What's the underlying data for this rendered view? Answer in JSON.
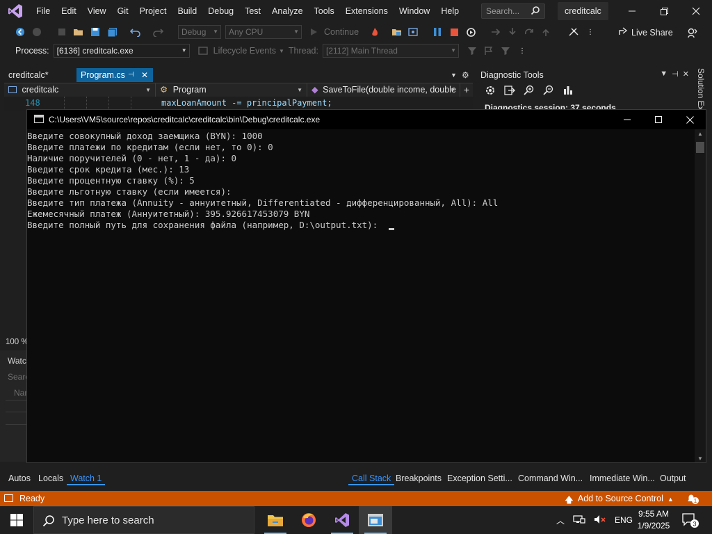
{
  "menu": {
    "items": [
      "File",
      "Edit",
      "View",
      "Git",
      "Project",
      "Build",
      "Debug",
      "Test",
      "Analyze",
      "Tools",
      "Extensions",
      "Window",
      "Help"
    ],
    "search_placeholder": "Search...",
    "solution_name": "creditcalc"
  },
  "toolbar": {
    "config": "Debug",
    "platform": "Any CPU",
    "continue_label": "Continue",
    "live_share": "Live Share"
  },
  "debug_location": {
    "process_label": "Process:",
    "process_value": "[6136] creditcalc.exe",
    "lifecycle_label": "Lifecycle Events",
    "thread_label": "Thread:",
    "thread_value": "[2112] Main Thread"
  },
  "editor": {
    "tabs": [
      {
        "label": "creditcalc*",
        "active": false
      },
      {
        "label": "Program.cs",
        "active": true
      }
    ],
    "nav": {
      "project": "creditcalc",
      "class": "Program",
      "member": "SaveToFile(double income, double"
    },
    "line_number": "148",
    "code_line": "maxLoanAmount -= principalPayment;"
  },
  "diagnostic": {
    "title": "Diagnostic Tools",
    "session": "Diagnostics session: 37 seconds"
  },
  "solution_explorer_label": "Solution Ex",
  "left_stubs": {
    "zoom": "100 %",
    "watch_title": "Watc",
    "search": "Searc",
    "name": "Nar"
  },
  "console": {
    "title": "C:\\Users\\VM5\\source\\repos\\creditcalc\\creditcalc\\bin\\Debug\\creditcalc.exe",
    "lines": [
      "Введите совокупный доход заемщика (BYN): 1000",
      "Введите платежи по кредитам (если нет, то 0): 0",
      "Наличие поручителей (0 - нет, 1 - да): 0",
      "Введите срок кредита (мес.): 13",
      "Введите процентную ставку (%): 5",
      "Введите льготную ставку (если имеется):",
      "Введите тип платежа (Annuity - аннуитетный, Differentiated - дифференцированный, All): All",
      "Ежемесячный платеж (Аннуитетный): 395.926617453079 BYN",
      "Введите полный путь для сохранения файла (например, D:\\output.txt): "
    ]
  },
  "bottom_tabs": {
    "left": [
      "Autos",
      "Locals",
      "Watch 1"
    ],
    "right": [
      "Call Stack",
      "Breakpoints",
      "Exception Setti...",
      "Command Win...",
      "Immediate Win...",
      "Output"
    ]
  },
  "status": {
    "ready": "Ready",
    "add_source": "Add to Source Control",
    "notifications": "1"
  },
  "taskbar": {
    "search_placeholder": "Type here to search",
    "lang": "ENG",
    "time": "9:55 AM",
    "date": "1/9/2025",
    "notif_count": "3"
  },
  "colors": {
    "accent": "#0e639c",
    "status_bar": "#ca5100",
    "active_tab_text": "#3794ff"
  }
}
